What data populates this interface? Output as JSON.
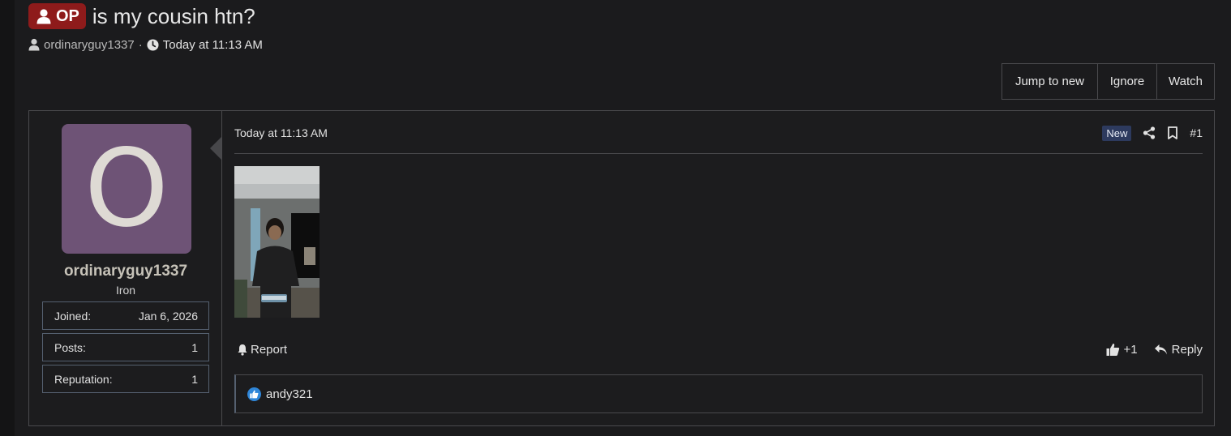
{
  "thread": {
    "op_badge": "OP",
    "title": "is my cousin htn?",
    "author": "ordinaryguy1337",
    "separator": "·",
    "time": "Today at 11:13 AM"
  },
  "actions": {
    "jump_to_new": "Jump to new",
    "ignore": "Ignore",
    "watch": "Watch"
  },
  "user": {
    "avatar_letter": "O",
    "avatar_color": "#6e5376",
    "name": "ordinaryguy1337",
    "rank": "Iron",
    "stats": [
      {
        "label": "Joined:",
        "value": "Jan 6, 2026"
      },
      {
        "label": "Posts:",
        "value": "1"
      },
      {
        "label": "Reputation:",
        "value": "1"
      }
    ]
  },
  "post": {
    "date": "Today at 11:13 AM",
    "new_badge": "New",
    "number": "#1",
    "report": "Report",
    "like_count": "+1",
    "reply": "Reply",
    "reactions": {
      "users": "andy321"
    }
  },
  "colors": {
    "background": "#1b1b1d",
    "op_badge": "#8e1b1b",
    "new_badge": "#2d3a5e",
    "like_blue": "#2f86d8"
  }
}
